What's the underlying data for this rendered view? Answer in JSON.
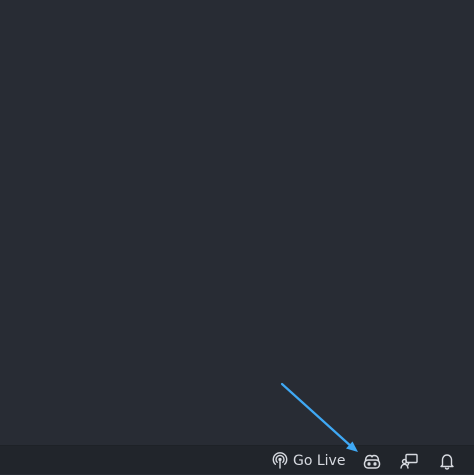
{
  "status_bar": {
    "go_live_label": "Go Live",
    "items": [
      {
        "icon": "broadcast-icon"
      },
      {
        "icon": "copilot-icon"
      },
      {
        "icon": "feedback-icon"
      },
      {
        "icon": "bell-icon"
      }
    ]
  },
  "colors": {
    "editor_background": "#282c34",
    "status_bar_background": "#21252b",
    "status_text": "#d7dae0",
    "annotation_arrow": "#3fa9f5"
  }
}
